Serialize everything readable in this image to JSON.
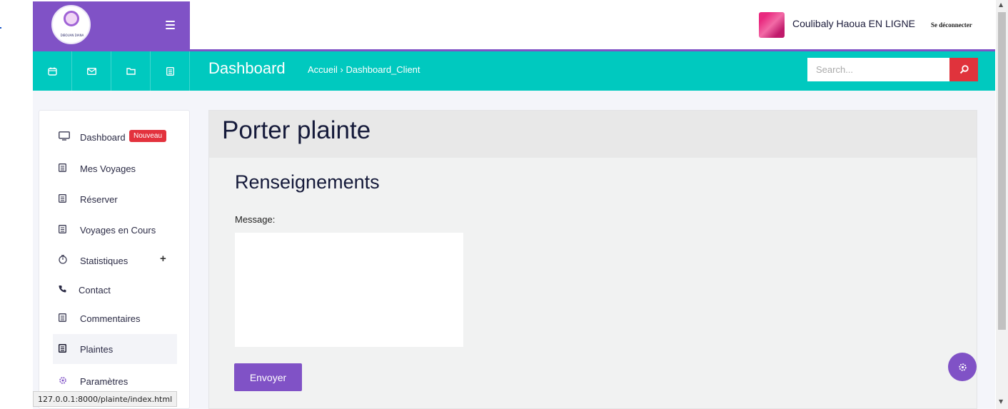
{
  "app": {
    "logo_text": "DIBOUAN DIANA"
  },
  "topbar": {
    "menu_icon": "hamburger-icon",
    "user_name": "Coulibaly Haoua EN LIGNE",
    "logout": "Se déconnecter"
  },
  "navbar": {
    "icons": [
      "calendar-icon",
      "mail-icon",
      "folder-icon",
      "list-icon"
    ],
    "title": "Dashboard",
    "breadcrumb": "Accueil › Dashboard_Client",
    "search_placeholder": "Search...",
    "search_icon": "search-icon"
  },
  "sidebar": {
    "items": [
      {
        "label": "Dashboard",
        "icon": "monitor-icon",
        "badge": "Nouveau"
      },
      {
        "label": "Mes Voyages",
        "icon": "list-icon"
      },
      {
        "label": "Réserver",
        "icon": "list-icon"
      },
      {
        "label": "Voyages en Cours",
        "icon": "list-icon"
      },
      {
        "label": "Statistiques",
        "icon": "chart-icon",
        "expand": "+"
      },
      {
        "label": "Contact",
        "icon": "phone-icon"
      },
      {
        "label": "Commentaires",
        "icon": "list-icon"
      },
      {
        "label": "Plaintes",
        "icon": "list-icon",
        "active": true
      },
      {
        "label": "Paramètres",
        "icon": "gear-icon"
      }
    ]
  },
  "content": {
    "title": "Porter plainte",
    "subtitle": "Renseignements",
    "message_label": "Message:",
    "message_value": "",
    "submit_label": "Envoyer"
  },
  "fab_icon": "settings-icon",
  "status_url": "127.0.0.1:8000/plainte/index.html",
  "colors": {
    "primary": "#8052c6",
    "teal": "#00c9bf",
    "danger": "#e3323d"
  }
}
